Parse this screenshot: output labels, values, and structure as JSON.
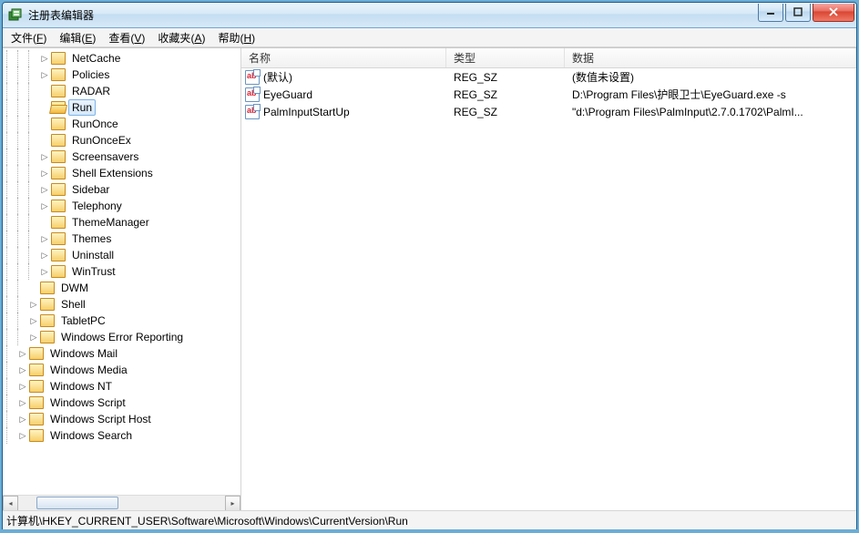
{
  "window": {
    "title": "注册表编辑器"
  },
  "menu": {
    "file": {
      "label": "文件",
      "accel": "F"
    },
    "edit": {
      "label": "编辑",
      "accel": "E"
    },
    "view": {
      "label": "查看",
      "accel": "V"
    },
    "fav": {
      "label": "收藏夹",
      "accel": "A"
    },
    "help": {
      "label": "帮助",
      "accel": "H"
    }
  },
  "tree": [
    {
      "depth": 15,
      "twisty": "▷",
      "open": false,
      "label": "NetCache",
      "selected": false
    },
    {
      "depth": 15,
      "twisty": "▷",
      "open": false,
      "label": "Policies",
      "selected": false
    },
    {
      "depth": 15,
      "twisty": "",
      "open": false,
      "label": "RADAR",
      "selected": false
    },
    {
      "depth": 15,
      "twisty": "",
      "open": true,
      "label": "Run",
      "selected": true
    },
    {
      "depth": 15,
      "twisty": "",
      "open": false,
      "label": "RunOnce",
      "selected": false
    },
    {
      "depth": 15,
      "twisty": "",
      "open": false,
      "label": "RunOnceEx",
      "selected": false
    },
    {
      "depth": 15,
      "twisty": "▷",
      "open": false,
      "label": "Screensavers",
      "selected": false
    },
    {
      "depth": 15,
      "twisty": "▷",
      "open": false,
      "label": "Shell Extensions",
      "selected": false
    },
    {
      "depth": 15,
      "twisty": "▷",
      "open": false,
      "label": "Sidebar",
      "selected": false
    },
    {
      "depth": 15,
      "twisty": "▷",
      "open": false,
      "label": "Telephony",
      "selected": false
    },
    {
      "depth": 15,
      "twisty": "",
      "open": false,
      "label": "ThemeManager",
      "selected": false
    },
    {
      "depth": 15,
      "twisty": "▷",
      "open": false,
      "label": "Themes",
      "selected": false
    },
    {
      "depth": 15,
      "twisty": "▷",
      "open": false,
      "label": "Uninstall",
      "selected": false
    },
    {
      "depth": 15,
      "twisty": "▷",
      "open": false,
      "label": "WinTrust",
      "selected": false
    },
    {
      "depth": 14,
      "twisty": "",
      "open": false,
      "label": "DWM",
      "selected": false
    },
    {
      "depth": 14,
      "twisty": "▷",
      "open": false,
      "label": "Shell",
      "selected": false
    },
    {
      "depth": 14,
      "twisty": "▷",
      "open": false,
      "label": "TabletPC",
      "selected": false
    },
    {
      "depth": 14,
      "twisty": "▷",
      "open": false,
      "label": "Windows Error Reporting",
      "selected": false
    },
    {
      "depth": 13,
      "twisty": "▷",
      "open": false,
      "label": "Windows Mail",
      "selected": false
    },
    {
      "depth": 13,
      "twisty": "▷",
      "open": false,
      "label": "Windows Media",
      "selected": false
    },
    {
      "depth": 13,
      "twisty": "▷",
      "open": false,
      "label": "Windows NT",
      "selected": false
    },
    {
      "depth": 13,
      "twisty": "▷",
      "open": false,
      "label": "Windows Script",
      "selected": false
    },
    {
      "depth": 13,
      "twisty": "▷",
      "open": false,
      "label": "Windows Script Host",
      "selected": false
    },
    {
      "depth": 13,
      "twisty": "▷",
      "open": false,
      "label": "Windows Search",
      "selected": false
    }
  ],
  "columns": {
    "name": "名称",
    "type": "类型",
    "data": "数据"
  },
  "values": [
    {
      "name": "(默认)",
      "type": "REG_SZ",
      "data": "(数值未设置)"
    },
    {
      "name": "EyeGuard",
      "type": "REG_SZ",
      "data": "D:\\Program Files\\护眼卫士\\EyeGuard.exe -s"
    },
    {
      "name": "PalmInputStartUp",
      "type": "REG_SZ",
      "data": "\"d:\\Program Files\\PalmInput\\2.7.0.1702\\PalmI..."
    }
  ],
  "status": "计算机\\HKEY_CURRENT_USER\\Software\\Microsoft\\Windows\\CurrentVersion\\Run"
}
